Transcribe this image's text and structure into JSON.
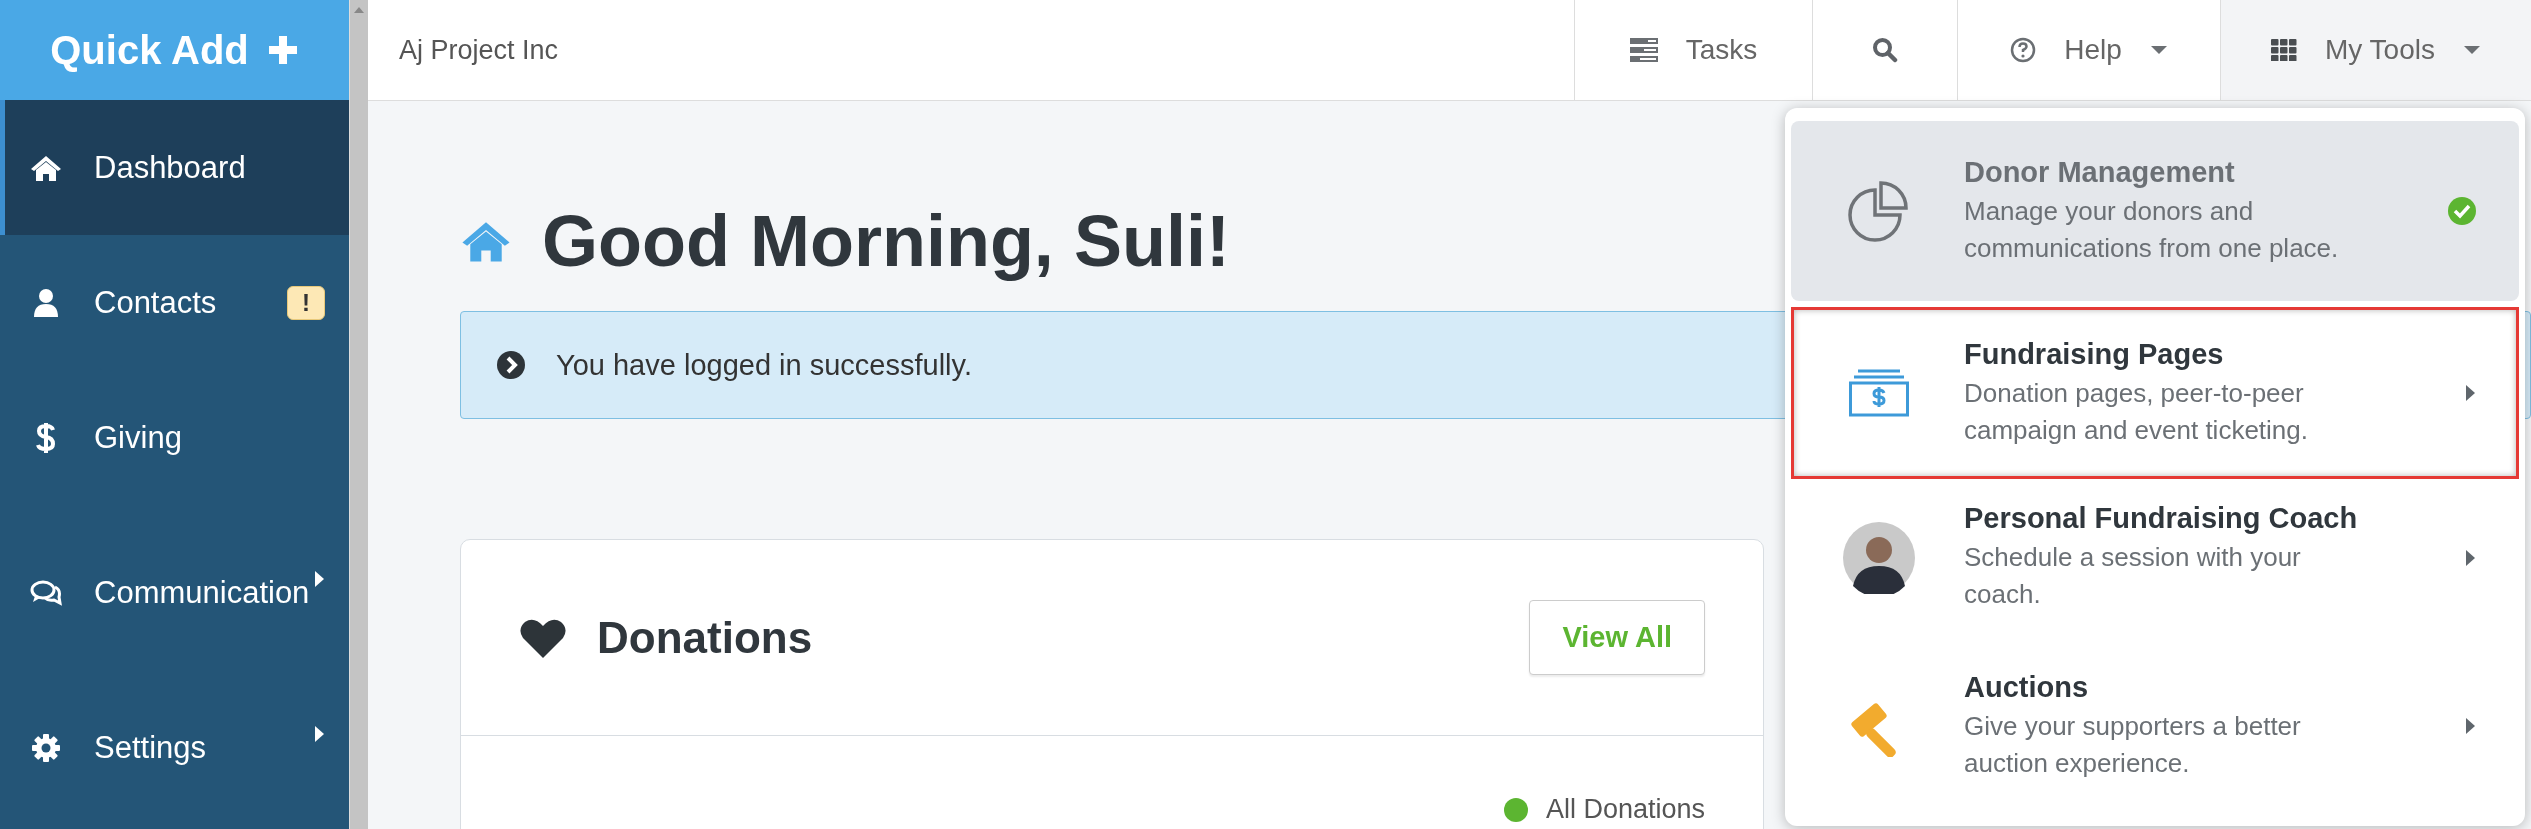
{
  "quick_add": {
    "label": "Quick Add"
  },
  "sidebar": {
    "items": [
      {
        "label": "Dashboard",
        "kind": "home",
        "selected": true
      },
      {
        "label": "Contacts",
        "kind": "user",
        "selected": false,
        "badge": "!"
      },
      {
        "label": "Giving",
        "kind": "dollar",
        "selected": false
      },
      {
        "label": "Communication",
        "kind": "chat",
        "selected": false,
        "expandable": true
      },
      {
        "label": "Settings",
        "kind": "gear",
        "selected": false,
        "expandable": true
      }
    ]
  },
  "top_bar": {
    "organization": "Aj Project Inc",
    "items": [
      {
        "label": "Tasks",
        "kind": "tasks",
        "open": false
      },
      {
        "kind": "search",
        "open": false
      },
      {
        "label": "Help",
        "kind": "help",
        "open": false,
        "dropdown": true
      },
      {
        "label": "My Tools",
        "kind": "grid",
        "open": true,
        "dropdown": true
      }
    ]
  },
  "greeting": "Good Morning, Suli!",
  "alert": "You have logged in successfully.",
  "donations_card": {
    "title": "Donations",
    "button": "View All",
    "legend": "All Donations"
  },
  "tools_menu": {
    "items": [
      {
        "title": "Donor Management",
        "description": "Manage your donors and communications from one place.",
        "kind": "chart",
        "active": true,
        "highlighted": false
      },
      {
        "title": "Fundraising Pages",
        "description": "Donation pages, peer-to-peer campaign and event ticketing.",
        "kind": "pages",
        "active": false,
        "highlighted": true
      },
      {
        "title": "Personal Fundraising Coach",
        "description": "Schedule a session with your coach.",
        "kind": "coach",
        "active": false,
        "highlighted": false
      },
      {
        "title": "Auctions",
        "description": "Give your supporters a better auction experience.",
        "kind": "gavel",
        "active": false,
        "highlighted": false
      }
    ]
  }
}
